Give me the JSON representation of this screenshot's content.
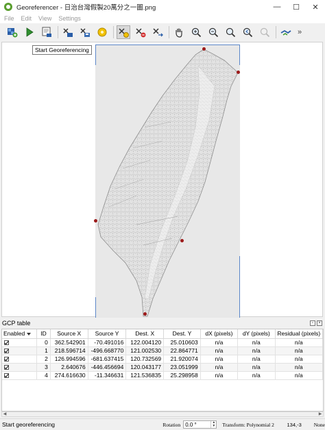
{
  "window": {
    "title": "Georeferencer - 日治台灣假製20萬分之一圖.png",
    "controls": {
      "minimize": "—",
      "maximize": "☐",
      "close": "✕"
    }
  },
  "menu": [
    "File",
    "Edit",
    "View",
    "Settings"
  ],
  "toolbar": {
    "buttons": [
      {
        "name": "add-raster-icon"
      },
      {
        "name": "start-georeferencing-icon"
      },
      {
        "name": "generate-gdal-script-icon"
      },
      {
        "name": "load-gcp-points-icon"
      },
      {
        "name": "save-gcp-points-icon"
      },
      {
        "name": "transformation-settings-icon"
      },
      {
        "name": "add-point-icon"
      },
      {
        "name": "delete-point-icon"
      },
      {
        "name": "move-gcp-point-icon"
      },
      {
        "name": "pan-icon"
      },
      {
        "name": "zoom-in-icon"
      },
      {
        "name": "zoom-out-icon"
      },
      {
        "name": "zoom-to-layer-icon"
      },
      {
        "name": "zoom-last-icon"
      },
      {
        "name": "zoom-next-icon"
      },
      {
        "name": "link-georeferencer-icon"
      }
    ],
    "more": "»"
  },
  "tooltip": "Start Georeferencing",
  "canvas": {
    "gcp_color": "#9c1a1a",
    "frame_color": "#5b86c8"
  },
  "gcp_table": {
    "title": "GCP table",
    "columns": [
      "Enabled",
      "ID",
      "Source X",
      "Source Y",
      "Dest. X",
      "Dest. Y",
      "dX (pixels)",
      "dY (pixels)",
      "Residual (pixels)"
    ],
    "rows": [
      {
        "enabled": true,
        "id": "0",
        "source_x": "362.542901",
        "source_y": "-70.491016",
        "dest_x": "122.004120",
        "dest_y": "25.010603",
        "dx": "n/a",
        "dy": "n/a",
        "residual": "n/a"
      },
      {
        "enabled": true,
        "id": "1",
        "source_x": "218.596714",
        "source_y": "-496.668770",
        "dest_x": "121.002530",
        "dest_y": "22.864771",
        "dx": "n/a",
        "dy": "n/a",
        "residual": "n/a"
      },
      {
        "enabled": true,
        "id": "2",
        "source_x": "126.994596",
        "source_y": "-681.637415",
        "dest_x": "120.732569",
        "dest_y": "21.920074",
        "dx": "n/a",
        "dy": "n/a",
        "residual": "n/a"
      },
      {
        "enabled": true,
        "id": "3",
        "source_x": "2.640676",
        "source_y": "-446.456694",
        "dest_x": "120.043177",
        "dest_y": "23.051999",
        "dx": "n/a",
        "dy": "n/a",
        "residual": "n/a"
      },
      {
        "enabled": true,
        "id": "4",
        "source_x": "274.616630",
        "source_y": "-11.346631",
        "dest_x": "121.536835",
        "dest_y": "25.298958",
        "dx": "n/a",
        "dy": "n/a",
        "residual": "n/a"
      }
    ]
  },
  "statusbar": {
    "message": "Start georeferencing",
    "rotation_label": "Rotation",
    "rotation_value": "0.0 °",
    "transform": "Transform: Polynomial 2",
    "coordinates": "134,-3",
    "srs": "None"
  }
}
